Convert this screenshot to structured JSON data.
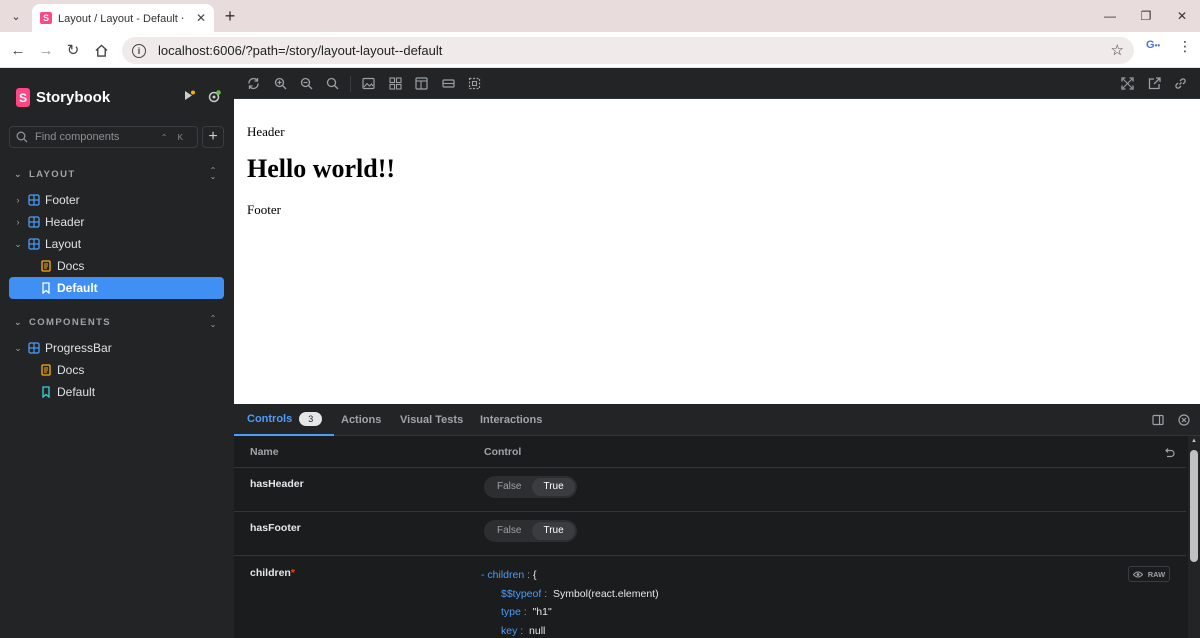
{
  "browser": {
    "tab_title": "Layout / Layout - Default ⋅ Storybook",
    "tab_favicon": "S",
    "url": "localhost:6006/?path=/story/layout-layout--default",
    "extension_label": "G"
  },
  "sidebar": {
    "brand": "Storybook",
    "brand_mark": "S",
    "search_placeholder": "Find components",
    "search_shortcut": "⌃ K",
    "sections": [
      {
        "title": "LAYOUT",
        "items": [
          {
            "label": "Footer",
            "type": "component",
            "expanded": false
          },
          {
            "label": "Header",
            "type": "component",
            "expanded": false
          },
          {
            "label": "Layout",
            "type": "component",
            "expanded": true
          },
          {
            "label": "Docs",
            "type": "docs"
          },
          {
            "label": "Default",
            "type": "story",
            "selected": true
          }
        ]
      },
      {
        "title": "COMPONENTS",
        "items": [
          {
            "label": "ProgressBar",
            "type": "component",
            "expanded": true
          },
          {
            "label": "Docs",
            "type": "docs"
          },
          {
            "label": "Default",
            "type": "story"
          }
        ]
      }
    ]
  },
  "canvas": {
    "header_text": "Header",
    "heading": "Hello world!!",
    "footer_text": "Footer"
  },
  "panel": {
    "tabs": [
      {
        "label": "Controls",
        "count": "3",
        "active": true
      },
      {
        "label": "Actions"
      },
      {
        "label": "Visual Tests"
      },
      {
        "label": "Interactions"
      }
    ],
    "columns": {
      "name": "Name",
      "control": "Control"
    },
    "rows": [
      {
        "name": "hasHeader",
        "false_label": "False",
        "true_label": "True",
        "value": true
      },
      {
        "name": "hasFooter",
        "false_label": "False",
        "true_label": "True",
        "value": true
      },
      {
        "name": "children",
        "required_mark": "*"
      }
    ],
    "children_object": {
      "collapse": "-",
      "root_key": "children",
      "open_brace": "{",
      "lines": [
        {
          "key": "$$typeof",
          "value": "Symbol(react.element)"
        },
        {
          "key": "type",
          "value": "\"h1\""
        },
        {
          "key": "key",
          "value": "null"
        }
      ]
    },
    "raw_label": "RAW"
  },
  "colors": {
    "brand_pink": "#ff4785",
    "selection_blue": "#3f8ff5",
    "active_tab_blue": "#4b9dfb",
    "sidebar_bg": "#222425"
  }
}
